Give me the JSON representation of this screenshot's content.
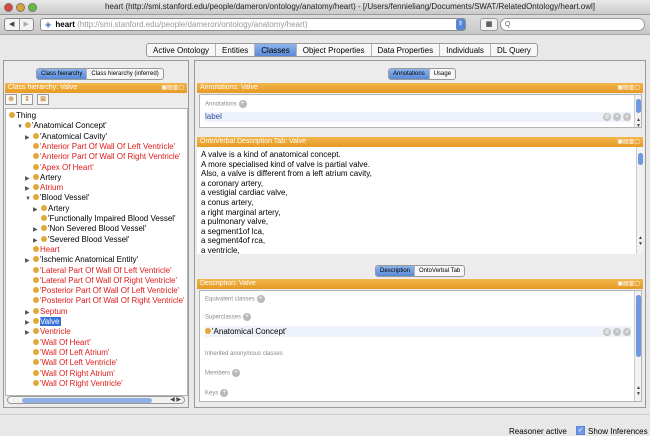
{
  "window": {
    "title": "heart (http://smi.stanford.edu/people/dameron/ontology/anatomy/heart) - [/Users/fennieliang/Documents/SWAT/RelatedOntology/heart.owl]"
  },
  "address": {
    "name": "heart",
    "url": "(http://smi.stanford.edu/people/dameron/ontology/anatomy/heart)",
    "search_placeholder": "Q"
  },
  "main_tabs": [
    "Active Ontology",
    "Entities",
    "Classes",
    "Object Properties",
    "Data Properties",
    "Individuals",
    "DL Query"
  ],
  "left": {
    "subtabs": [
      "Class hierarchy",
      "Class hierarchy (inferred)"
    ],
    "header": "Class hierarchy: Valve",
    "tree": [
      {
        "label": "Thing",
        "indent": 0,
        "arrow": "",
        "red": false,
        "sel": false,
        "dot": false
      },
      {
        "label": "'Anatomical Concept'",
        "indent": 1,
        "arrow": "▼",
        "red": false,
        "sel": false,
        "dot": true
      },
      {
        "label": "'Anatomical Cavity'",
        "indent": 2,
        "arrow": "▶",
        "red": false,
        "sel": false,
        "dot": true
      },
      {
        "label": "'Anterior Part Of Wall Of Left Ventricle'",
        "indent": 2,
        "arrow": "",
        "red": true,
        "sel": false,
        "dot": true
      },
      {
        "label": "'Anterior Part Of Wall Of Right Ventricle'",
        "indent": 2,
        "arrow": "",
        "red": true,
        "sel": false,
        "dot": true
      },
      {
        "label": "'Apex Of Heart'",
        "indent": 2,
        "arrow": "",
        "red": true,
        "sel": false,
        "dot": true
      },
      {
        "label": "Artery",
        "indent": 2,
        "arrow": "▶",
        "red": false,
        "sel": false,
        "dot": true
      },
      {
        "label": "Atrium",
        "indent": 2,
        "arrow": "▶",
        "red": true,
        "sel": false,
        "dot": true
      },
      {
        "label": "'Blood Vessel'",
        "indent": 2,
        "arrow": "▼",
        "red": false,
        "sel": false,
        "dot": true
      },
      {
        "label": "Artery",
        "indent": 3,
        "arrow": "▶",
        "red": false,
        "sel": false,
        "dot": true
      },
      {
        "label": "'Functionally Impaired Blood Vessel'",
        "indent": 3,
        "arrow": "",
        "red": false,
        "sel": false,
        "dot": true
      },
      {
        "label": "'Non Severed Blood Vessel'",
        "indent": 3,
        "arrow": "▶",
        "red": false,
        "sel": false,
        "dot": true
      },
      {
        "label": "'Severed Blood Vessel'",
        "indent": 3,
        "arrow": "▶",
        "red": false,
        "sel": false,
        "dot": true
      },
      {
        "label": "Heart",
        "indent": 2,
        "arrow": "",
        "red": true,
        "sel": false,
        "dot": true
      },
      {
        "label": "'Ischemic Anatomical Entity'",
        "indent": 2,
        "arrow": "▶",
        "red": false,
        "sel": false,
        "dot": true
      },
      {
        "label": "'Lateral Part Of Wall Of Left Ventricle'",
        "indent": 2,
        "arrow": "",
        "red": true,
        "sel": false,
        "dot": true
      },
      {
        "label": "'Lateral Part Of Wall Of Right Ventricle'",
        "indent": 2,
        "arrow": "",
        "red": true,
        "sel": false,
        "dot": true
      },
      {
        "label": "'Posterior Part Of Wall Of Left Ventricle'",
        "indent": 2,
        "arrow": "",
        "red": true,
        "sel": false,
        "dot": true
      },
      {
        "label": "'Posterior Part Of Wall Of Right Ventricle'",
        "indent": 2,
        "arrow": "",
        "red": true,
        "sel": false,
        "dot": true
      },
      {
        "label": "Septum",
        "indent": 2,
        "arrow": "▶",
        "red": true,
        "sel": false,
        "dot": true
      },
      {
        "label": "Valve",
        "indent": 2,
        "arrow": "▶",
        "red": false,
        "sel": true,
        "dot": true
      },
      {
        "label": "Ventricle",
        "indent": 2,
        "arrow": "▶",
        "red": true,
        "sel": false,
        "dot": true
      },
      {
        "label": "'Wall Of Heart'",
        "indent": 2,
        "arrow": "",
        "red": true,
        "sel": false,
        "dot": true
      },
      {
        "label": "'Wall Of Left Atrium'",
        "indent": 2,
        "arrow": "",
        "red": true,
        "sel": false,
        "dot": true
      },
      {
        "label": "'Wall Of Left Ventricle'",
        "indent": 2,
        "arrow": "",
        "red": true,
        "sel": false,
        "dot": true
      },
      {
        "label": "'Wall Of Right Atrium'",
        "indent": 2,
        "arrow": "",
        "red": true,
        "sel": false,
        "dot": true
      },
      {
        "label": "'Wall Of Right Ventricle'",
        "indent": 2,
        "arrow": "",
        "red": true,
        "sel": false,
        "dot": true
      }
    ]
  },
  "right": {
    "top_subtabs": [
      "Annotations",
      "Usage"
    ],
    "annotations_header": "Annotations: Valve",
    "annotations_label": "Annotations",
    "annotation_row": "label",
    "ontoverbal_header": "OntoVerbal Description Tab: Valve",
    "ontoverbal_lines": [
      "A valve is a kind of anatomical concept.",
      "A more specialised kind of valve is partial valve.",
      "Also, a valve is different from a left atrium cavity,",
      "a coronary artery,",
      "a vestigial cardiac valve,",
      "a conus artery,",
      "a right marginal artery,",
      "a pulmonary valve,",
      "a segment1of lca,",
      "a segment4of rca,",
      "a ventricle,",
      "an interventricular septum,"
    ],
    "bottom_subtabs": [
      "Description",
      "OntoVerbal Tab"
    ],
    "description_header": "Description: Valve",
    "sections": {
      "equivalent": "Equivalent classes",
      "superclasses": "Superclasses",
      "superclass_item": "'Anatomical Concept'",
      "inherited": "Inherited anonymous classes",
      "members": "Members",
      "keys": "Keys"
    }
  },
  "status": {
    "reasoner": "Reasoner active",
    "show_inferences": "Show Inferences"
  }
}
